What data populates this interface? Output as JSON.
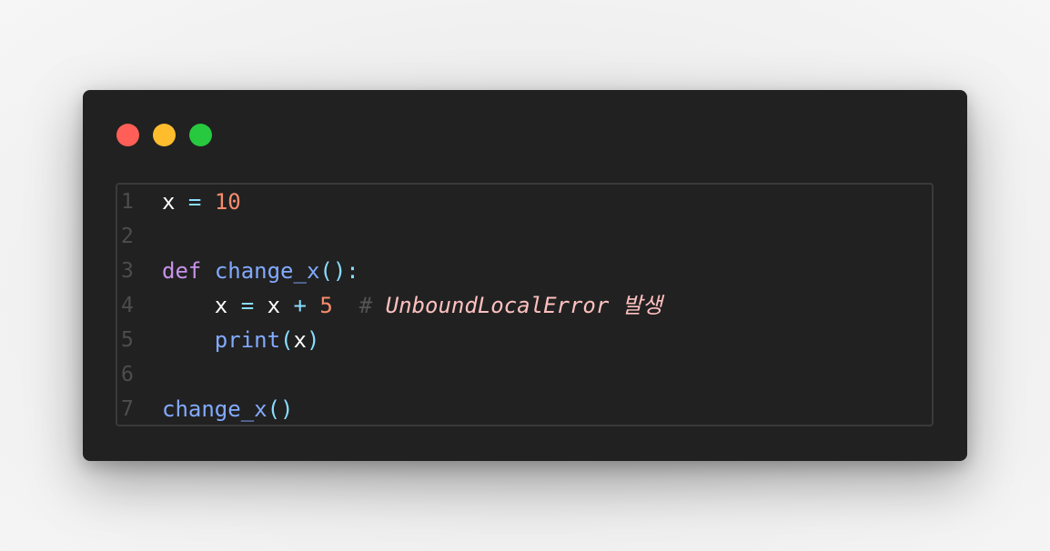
{
  "window": {
    "controls": [
      {
        "name": "close",
        "color": "#ff5f56"
      },
      {
        "name": "minimize",
        "color": "#ffbd2e"
      },
      {
        "name": "maximize",
        "color": "#27c93f"
      }
    ]
  },
  "code": {
    "lines": [
      {
        "number": "1",
        "tokens": [
          {
            "text": "x",
            "type": "var"
          },
          {
            "text": " ",
            "type": "space"
          },
          {
            "text": "=",
            "type": "op"
          },
          {
            "text": " ",
            "type": "space"
          },
          {
            "text": "10",
            "type": "num"
          }
        ]
      },
      {
        "number": "2",
        "tokens": []
      },
      {
        "number": "3",
        "tokens": [
          {
            "text": "def",
            "type": "kw"
          },
          {
            "text": " ",
            "type": "space"
          },
          {
            "text": "change_x",
            "type": "fn"
          },
          {
            "text": "():",
            "type": "paren"
          }
        ]
      },
      {
        "number": "4",
        "tokens": [
          {
            "text": "    ",
            "type": "space"
          },
          {
            "text": "x",
            "type": "var"
          },
          {
            "text": " ",
            "type": "space"
          },
          {
            "text": "=",
            "type": "op"
          },
          {
            "text": " ",
            "type": "space"
          },
          {
            "text": "x",
            "type": "var"
          },
          {
            "text": " ",
            "type": "space"
          },
          {
            "text": "+",
            "type": "op"
          },
          {
            "text": " ",
            "type": "space"
          },
          {
            "text": "5",
            "type": "num"
          },
          {
            "text": "  ",
            "type": "space"
          },
          {
            "text": "#",
            "type": "hash"
          },
          {
            "text": " ",
            "type": "space"
          },
          {
            "text": "UnboundLocalError 발생",
            "type": "comment"
          }
        ]
      },
      {
        "number": "5",
        "tokens": [
          {
            "text": "    ",
            "type": "space"
          },
          {
            "text": "print",
            "type": "fn"
          },
          {
            "text": "(",
            "type": "paren"
          },
          {
            "text": "x",
            "type": "var"
          },
          {
            "text": ")",
            "type": "paren"
          }
        ]
      },
      {
        "number": "6",
        "tokens": []
      },
      {
        "number": "7",
        "tokens": [
          {
            "text": "change_x",
            "type": "fn"
          },
          {
            "text": "()",
            "type": "paren"
          }
        ]
      }
    ]
  }
}
